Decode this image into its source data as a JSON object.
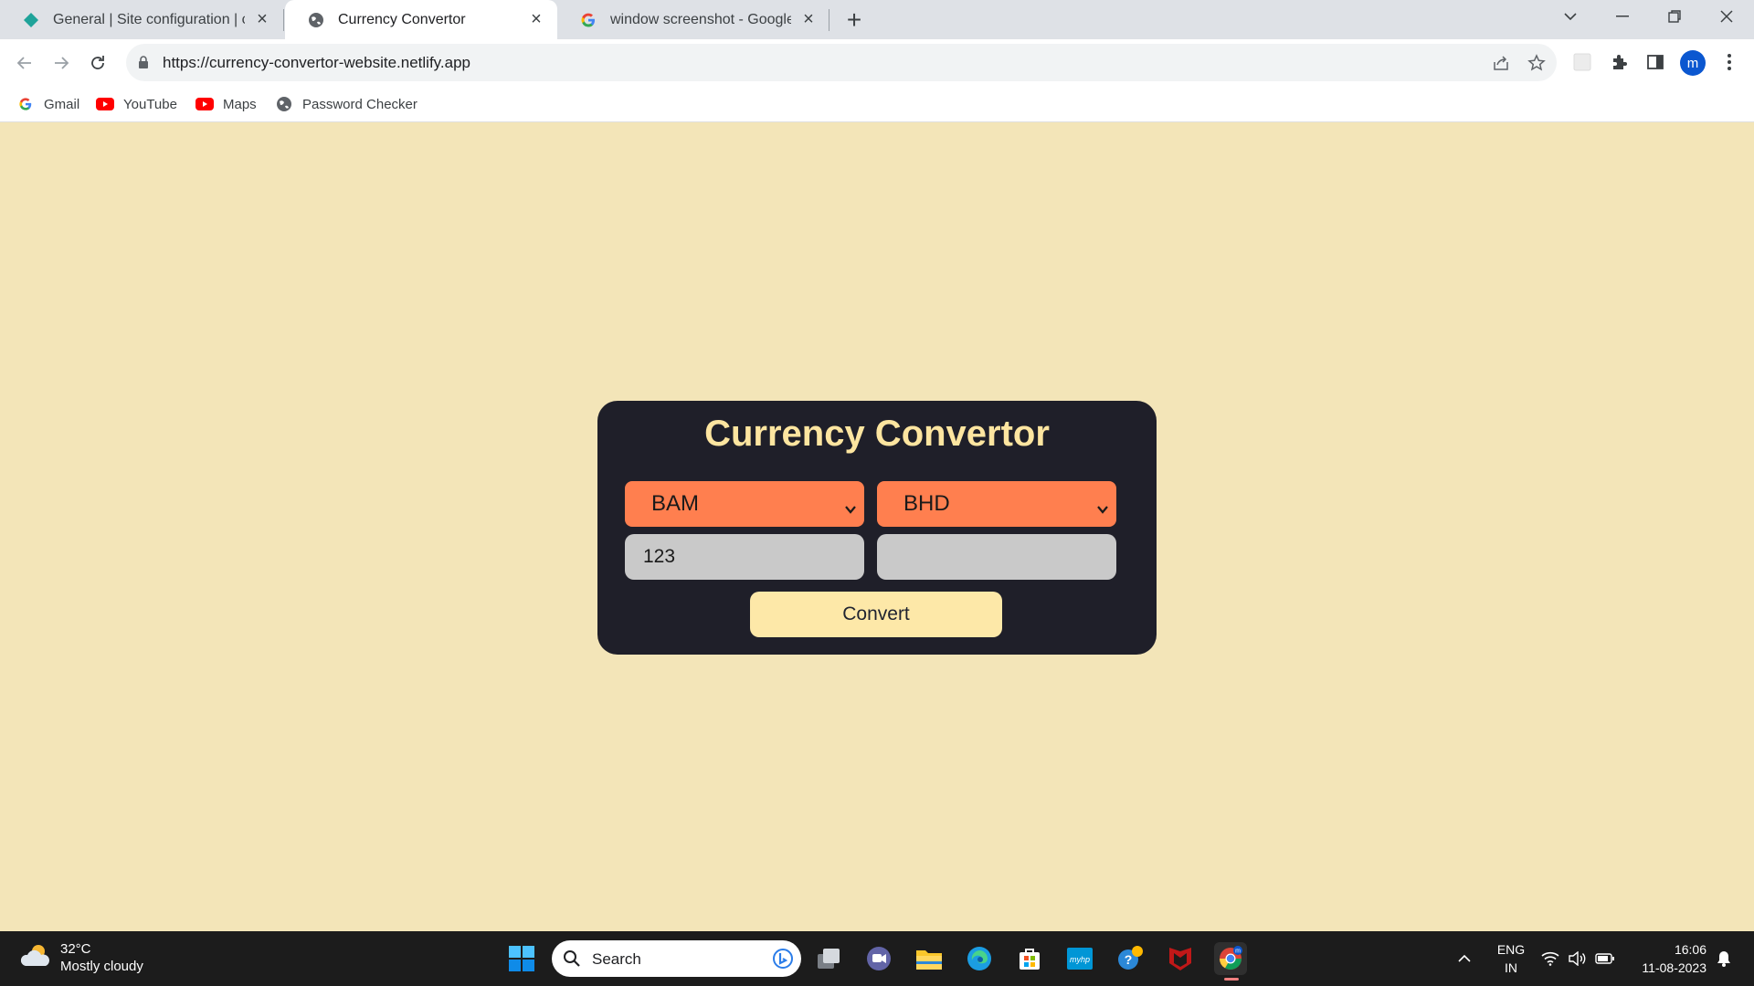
{
  "browser": {
    "tabs": [
      {
        "title": "General | Site configuration | currency-convertor-website",
        "favicon": "netlify-diamond-icon"
      },
      {
        "title": "Currency Convertor",
        "favicon": "globe-icon"
      },
      {
        "title": "window screenshot - Google Search",
        "favicon": "google-g-icon"
      }
    ],
    "active_tab": 1,
    "url": "https://currency-convertor-website.netlify.app",
    "profile_initial": "m",
    "bookmarks": [
      {
        "label": "Gmail",
        "icon": "google-g-icon"
      },
      {
        "label": "YouTube",
        "icon": "youtube-icon"
      },
      {
        "label": "Maps",
        "icon": "youtube-icon"
      },
      {
        "label": "Password Checker",
        "icon": "globe-icon"
      }
    ]
  },
  "app": {
    "title": "Currency Convertor",
    "from_currency": "BAM",
    "to_currency": "BHD",
    "amount": "123",
    "result": "",
    "convert_label": "Convert",
    "colors": {
      "page_bg": "#f3e5b8",
      "card_bg": "#1f1f29",
      "title": "#fde5a0",
      "select_bg": "#ff7f4f",
      "field_bg": "#c9c9c9",
      "button_bg": "#fde8a8"
    }
  },
  "taskbar": {
    "weather_temp": "32°C",
    "weather_condition": "Mostly cloudy",
    "search_label": "Search",
    "lang_line1": "ENG",
    "lang_line2": "IN",
    "time": "16:06",
    "date": "11-08-2023"
  }
}
